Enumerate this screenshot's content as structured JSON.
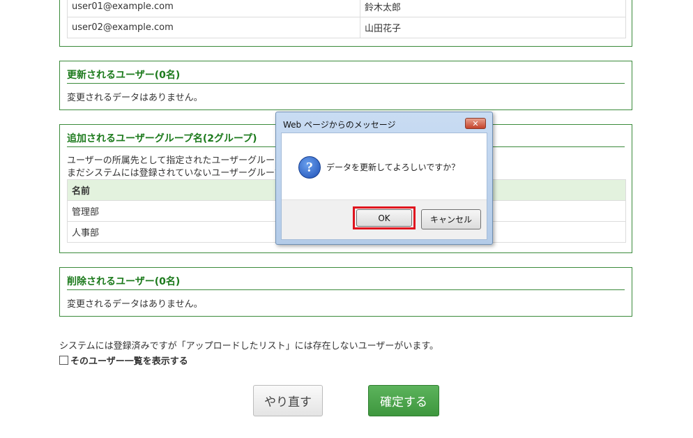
{
  "users_section": {
    "rows": [
      {
        "email": "user01@example.com",
        "name": "鈴木太郎"
      },
      {
        "email": "user02@example.com",
        "name": "山田花子"
      }
    ]
  },
  "updated_section": {
    "title": "更新されるユーザー(0名)",
    "message": "変更されるデータはありません。"
  },
  "groups_section": {
    "title": "追加されるユーザーグループ名(2グループ)",
    "desc_line1": "ユーザーの所属先として指定されたユーザーグループのうち、",
    "desc_line2": "まだシステムには登録されていないユーザーグループです。",
    "column_header": "名前",
    "rows": [
      "管理部",
      "人事部"
    ]
  },
  "deleted_section": {
    "title": "削除されるユーザー(0名)",
    "message": "変更されるデータはありません。"
  },
  "footer": {
    "note": "システムには登録済みですが「アップロードしたリスト」には存在しないユーザーがいます。",
    "checkbox_label": "そのユーザー一覧を表示する",
    "retry_label": "やり直す",
    "confirm_label": "確定する"
  },
  "dialog": {
    "title": "Web ページからのメッセージ",
    "close_glyph": "✕",
    "icon_glyph": "?",
    "message": "データを更新してよろしいですか？",
    "ok_label": "OK",
    "cancel_label": "キャンセル"
  },
  "colors": {
    "section_border": "#3a8a3a",
    "title_green": "#1c7a1c",
    "table_header_bg": "#e3f2de",
    "confirm_green": "#4aa54a",
    "highlight_red": "#e0141e"
  }
}
